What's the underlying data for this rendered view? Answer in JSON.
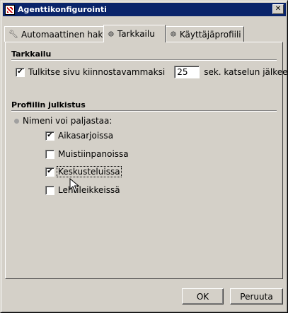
{
  "window": {
    "title": "Agenttikonfigurointi",
    "close_glyph": "✕"
  },
  "tabs": [
    {
      "label": "Automaattinen haku",
      "icon": "wrench-icon",
      "active": false
    },
    {
      "label": "Tarkkailu",
      "icon": "agent-icon",
      "active": true
    },
    {
      "label": "Käyttäjäprofiili",
      "icon": "agent-icon",
      "active": false
    }
  ],
  "monitoring": {
    "heading": "Tarkkailu",
    "checkbox_label": "Tulkitse sivu kiinnostavammaksi",
    "checked": true,
    "seconds_value": "25",
    "suffix": "sek. katselun jälkeen"
  },
  "profile": {
    "heading": "Profiilin julkistus",
    "radio_label": "Nimeni voi paljastaa:",
    "options": [
      {
        "label": "Aikasarjoissa",
        "checked": true
      },
      {
        "label": "Muistiinpanoissa",
        "checked": false
      },
      {
        "label": "Keskusteluissa",
        "checked": true
      },
      {
        "label": "Lehtileikkeissä",
        "checked": false
      }
    ]
  },
  "buttons": {
    "ok": "OK",
    "cancel": "Peruuta"
  },
  "check_glyph": "✔"
}
